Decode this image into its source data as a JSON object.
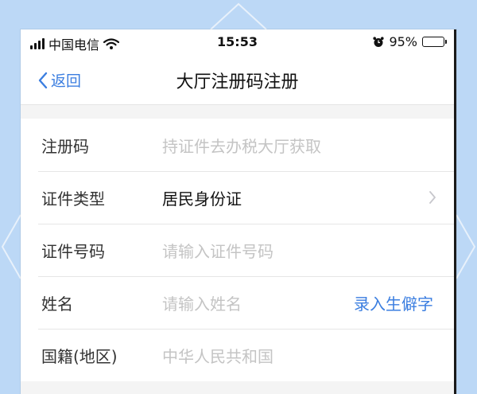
{
  "status_bar": {
    "carrier": "中国电信",
    "time": "15:53",
    "battery_percent": "95%",
    "battery_level": 0.95
  },
  "nav": {
    "back_label": "返回",
    "title": "大厅注册码注册"
  },
  "form": {
    "rows": [
      {
        "label": "注册码",
        "placeholder": "持证件去办税大厅获取"
      },
      {
        "label": "证件类型",
        "value": "居民身份证"
      },
      {
        "label": "证件号码",
        "placeholder": "请输入证件号码"
      },
      {
        "label": "姓名",
        "placeholder": "请输入姓名",
        "action": "录入生僻字"
      },
      {
        "label": "国籍(地区)",
        "placeholder": "中华人民共和国"
      }
    ]
  },
  "colors": {
    "accent": "#3b7ee0",
    "placeholder": "#c4c4c4",
    "backdrop": "#bcd8f6"
  },
  "icons": [
    "signal-icon",
    "wifi-icon",
    "alarm-icon",
    "battery-icon",
    "chevron-left-icon",
    "chevron-right-icon"
  ]
}
